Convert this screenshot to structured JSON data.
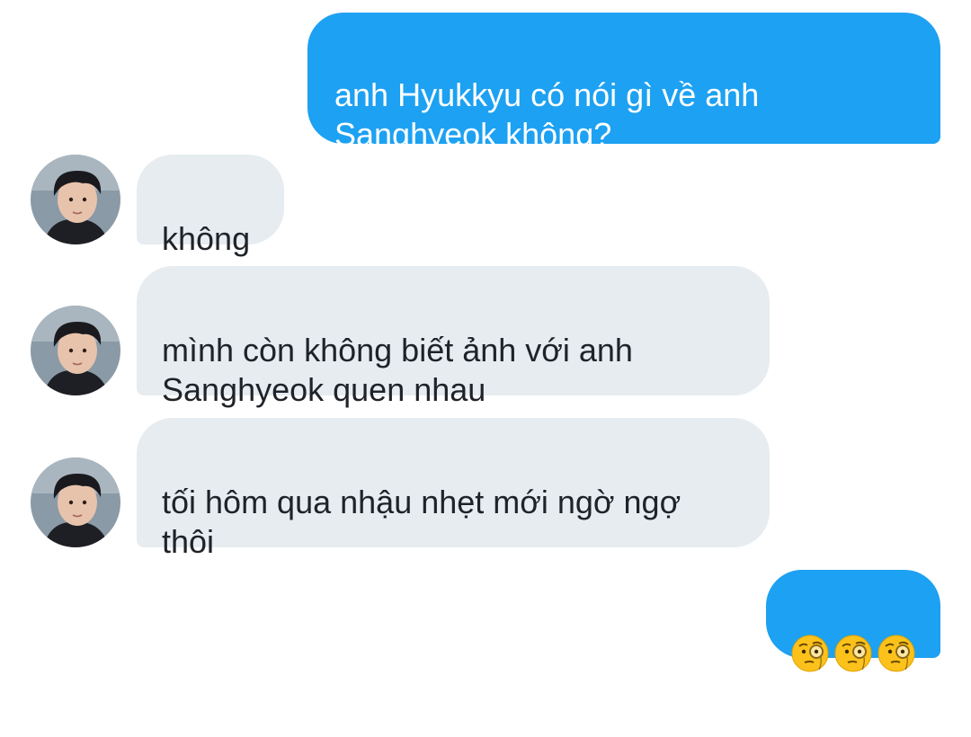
{
  "colors": {
    "outgoing_bubble": "#1da1f2",
    "incoming_bubble": "#e6ecf0",
    "outgoing_text": "#ffffff",
    "incoming_text": "#1f2329"
  },
  "messages": [
    {
      "direction": "outgoing",
      "text": "anh Hyukkyu có nói gì về anh\nSanghyeok không?"
    },
    {
      "direction": "incoming",
      "avatar": "profile-photo",
      "text": "không"
    },
    {
      "direction": "incoming",
      "avatar": "profile-photo",
      "text": "mình còn không biết ảnh với anh\nSanghyeok quen nhau"
    },
    {
      "direction": "incoming",
      "avatar": "profile-photo",
      "text": "tối hôm qua nhậu nhẹt mới ngờ ngợ\nthôi"
    },
    {
      "direction": "outgoing",
      "emoji": [
        "face-with-monocle",
        "face-with-monocle",
        "face-with-monocle"
      ]
    }
  ]
}
